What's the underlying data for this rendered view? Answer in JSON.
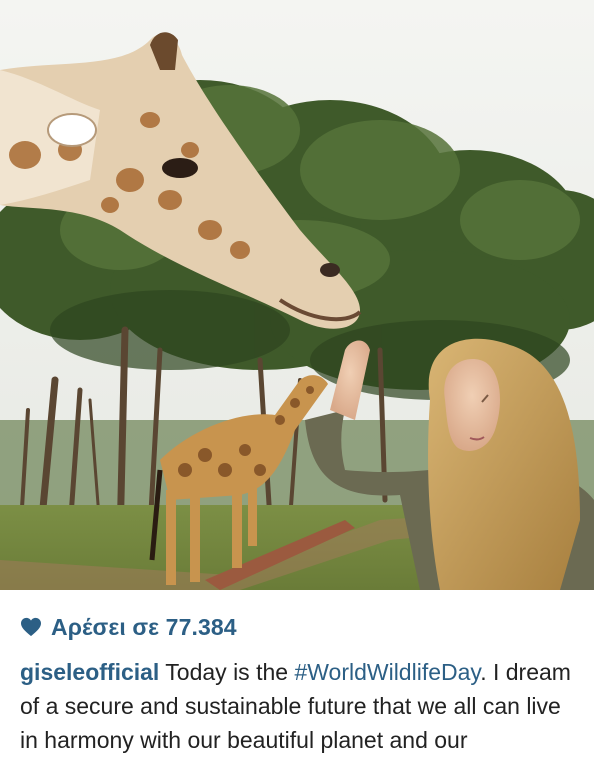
{
  "post": {
    "likes_label": "Αρέσει σε 77.384",
    "username": "giseleofficial",
    "caption_before": " Today is the ",
    "hashtag": "#WorldWildlifeDay",
    "caption_after": ". I dream of a secure and sustainable future that we all can live in harmony with our beautiful planet and our"
  },
  "colors": {
    "link_blue": "#2c5f85",
    "text": "#222222",
    "heart": "#2c5f85"
  },
  "icons": {
    "like": "heart-icon"
  }
}
